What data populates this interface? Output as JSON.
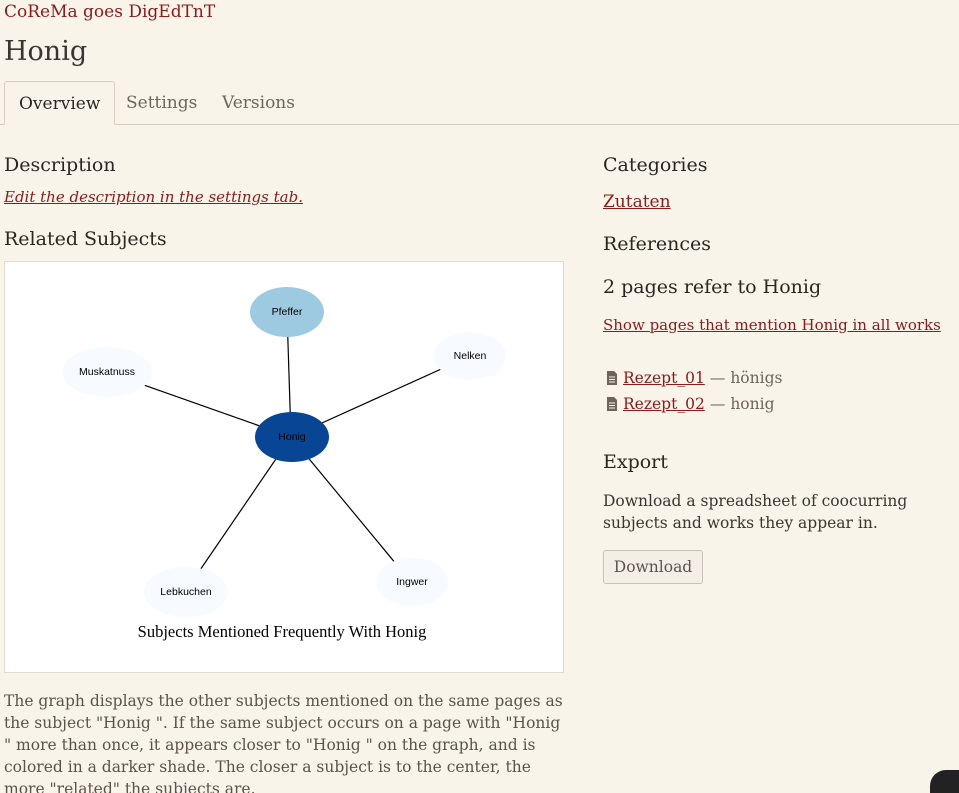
{
  "header": {
    "project": "CoReMa goes DigEdTnT",
    "title": "Honig"
  },
  "tabs": [
    {
      "label": "Overview",
      "active": true
    },
    {
      "label": "Settings",
      "active": false
    },
    {
      "label": "Versions",
      "active": false
    }
  ],
  "left": {
    "description_heading": "Description",
    "edit_description": "Edit the description in the settings tab.",
    "related_heading": "Related Subjects",
    "graph": {
      "center": "Honig",
      "title": "Subjects Mentioned Frequently With Honig",
      "nodes": [
        {
          "label": "Pfeffer",
          "color": "#9ecae1"
        },
        {
          "label": "Nelken",
          "color": "#f7fbff"
        },
        {
          "label": "Muskatnuss",
          "color": "#f7fbff"
        },
        {
          "label": "Lebkuchen",
          "color": "#f7fbff"
        },
        {
          "label": "Ingwer",
          "color": "#f7fbff"
        }
      ],
      "center_color": "#084594"
    },
    "caption": "The graph displays the other subjects mentioned on the same pages as the subject \"Honig \". If the same subject occurs on a page with \"Honig \" more than once, it appears closer to \"Honig \" on the graph, and is colored in a darker shade. The closer a subject is to the center, the more \"related\" the subjects are."
  },
  "right": {
    "categories_heading": "Categories",
    "category": "Zutaten",
    "references_heading": "References",
    "ref_count_text": "2 pages refer to Honig",
    "show_pages": "Show pages that mention Honig in all works",
    "refs": [
      {
        "link": "Rezept_01",
        "sep": "—",
        "term": "hönigs"
      },
      {
        "link": "Rezept_02",
        "sep": "—",
        "term": "honig"
      }
    ],
    "export_heading": "Export",
    "export_text": "Download a spreadsheet of coocurring subjects and works they appear in.",
    "download_label": "Download"
  },
  "colors": {
    "accent": "#8b1a1a",
    "background": "#f8f4ea"
  }
}
